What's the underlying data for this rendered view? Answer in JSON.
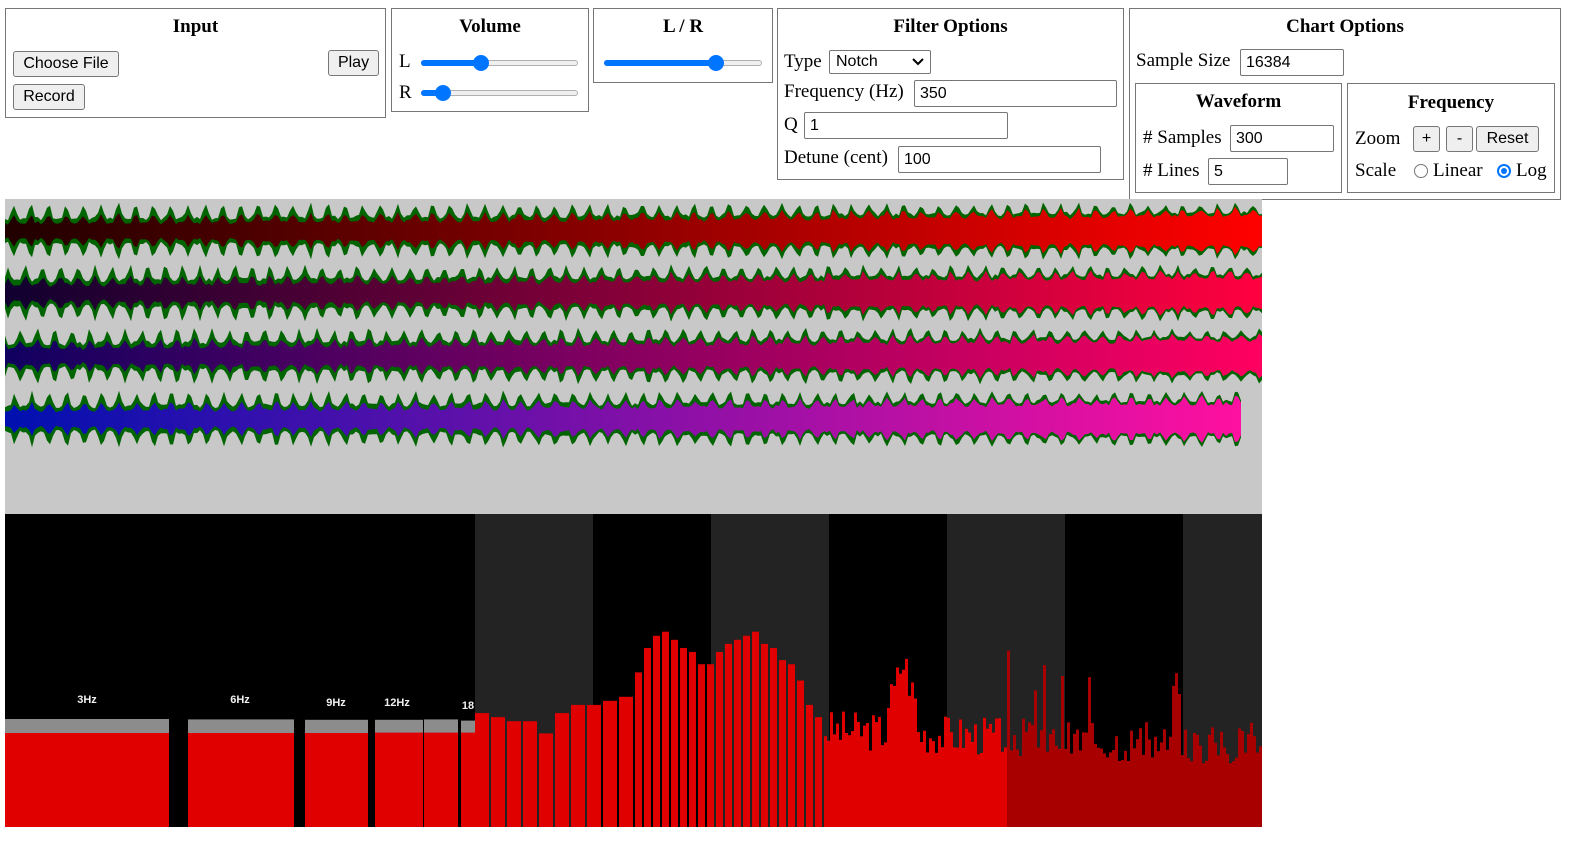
{
  "input": {
    "title": "Input",
    "choose_file": "Choose File",
    "play": "Play",
    "record": "Record"
  },
  "volume": {
    "title": "Volume",
    "left_label": "L",
    "right_label": "R",
    "left_level": 0.38,
    "right_level": 0.14
  },
  "balance": {
    "title": "L / R",
    "level": 0.71
  },
  "filter": {
    "title": "Filter Options",
    "type_label": "Type",
    "type_value": "Notch",
    "frequency_label": "Frequency (Hz)",
    "frequency_value": "350",
    "q_label": "Q",
    "q_value": "1",
    "detune_label": "Detune (cent)",
    "detune_value": "100"
  },
  "chart_options": {
    "title": "Chart Options",
    "sample_size_label": "Sample Size",
    "sample_size_value": "16384",
    "waveform": {
      "title": "Waveform",
      "samples_label": "# Samples",
      "samples_value": "300",
      "lines_label": "# Lines",
      "lines_value": "5"
    },
    "frequency": {
      "title": "Frequency",
      "zoom_label": "Zoom",
      "zoom_in": "+",
      "zoom_out": "-",
      "reset": "Reset",
      "scale_label": "Scale",
      "linear_label": "Linear",
      "log_label": "Log",
      "scale_selected": "Log"
    }
  },
  "colors": {
    "accent": "#0075ff",
    "wave_envelope": "#006400",
    "spectrum_bar": "#e00000",
    "spectrum_peak": "#8c8c8c",
    "spectrum_background": "#000000",
    "spectrum_band": "#232323",
    "waveform_background": "#c8c8c8"
  },
  "frequency_markers": [
    "3Hz",
    "6Hz",
    "9Hz",
    "12Hz",
    "18"
  ],
  "chart_data": [
    {
      "type": "area",
      "description_of_series": "waveform rows",
      "series": [
        {
          "start_color": "#200000",
          "end_color": "#ff0000",
          "extent": 1.0
        },
        {
          "start_color": "#100030",
          "end_color": "#ff0040",
          "extent": 1.0
        },
        {
          "start_color": "#100060",
          "end_color": "#ff0060",
          "extent": 1.0
        },
        {
          "start_color": "#0010b0",
          "end_color": "#ff10a0",
          "extent": 0.985
        }
      ]
    },
    {
      "type": "bar",
      "categories": [
        "3Hz",
        "6Hz",
        "9Hz",
        "12Hz",
        "18"
      ],
      "large_bar_values": [
        0.3,
        0.3,
        0.3,
        0.31,
        0.31,
        0.31
      ],
      "large_bar_peaks": [
        0.35,
        0.34,
        0.33,
        0.33,
        0.34,
        0.31
      ],
      "mid_bar_values": [
        0.28,
        0.27,
        0.26,
        0.26,
        0.23,
        0.28,
        0.3,
        0.3,
        0.31,
        0.32,
        0.38,
        0.44,
        0.47,
        0.48,
        0.46,
        0.44,
        0.43,
        0.4,
        0.4,
        0.43,
        0.45,
        0.46,
        0.47,
        0.48,
        0.45,
        0.44,
        0.41,
        0.4,
        0.36,
        0.3,
        0.27
      ]
    }
  ]
}
